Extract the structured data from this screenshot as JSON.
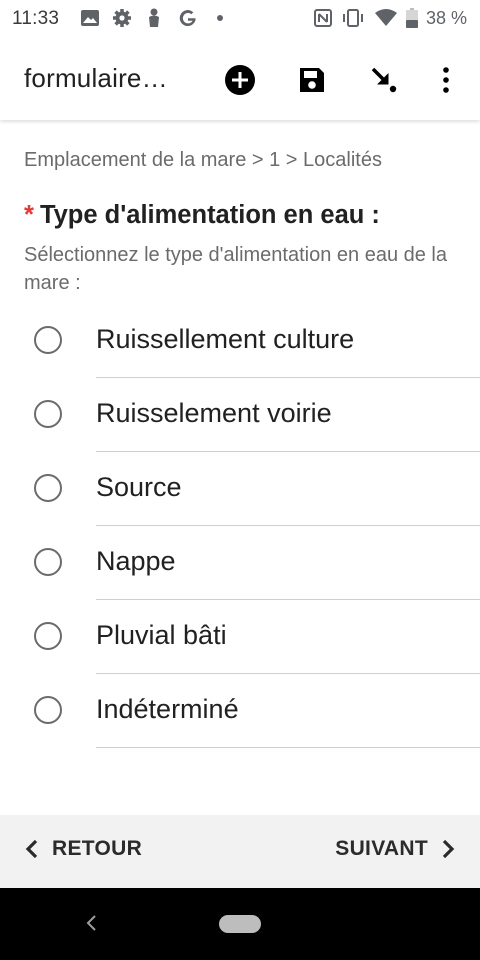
{
  "status_bar": {
    "time": "11:33",
    "battery": "38 %",
    "left_icons": [
      "image-icon",
      "gear-icon",
      "accessibility-icon",
      "google-icon",
      "dot-icon"
    ],
    "right_icons": [
      "nfc-icon",
      "vibrate-icon",
      "wifi-icon",
      "battery-icon"
    ]
  },
  "app_bar": {
    "title": "formulaire…",
    "actions": [
      "add-circle-icon",
      "save-icon",
      "arrow-to-point-icon",
      "more-vert-icon"
    ]
  },
  "breadcrumb": "Emplacement de la mare > 1 > Localités",
  "question": {
    "required_mark": "*",
    "label": "Type d'alimentation en eau :",
    "hint": "Sélectionnez le type d'alimentation en eau de la mare :"
  },
  "options": [
    "Ruissellement culture",
    "Ruisselement voirie",
    "Source",
    "Nappe",
    "Pluvial bâti",
    "Indéterminé"
  ],
  "navigation": {
    "back_label": "RETOUR",
    "next_label": "SUIVANT"
  },
  "colors": {
    "required": "#e53935",
    "nav_bar_bg": "#f2f2f2",
    "system_nav_bg": "#000000"
  }
}
